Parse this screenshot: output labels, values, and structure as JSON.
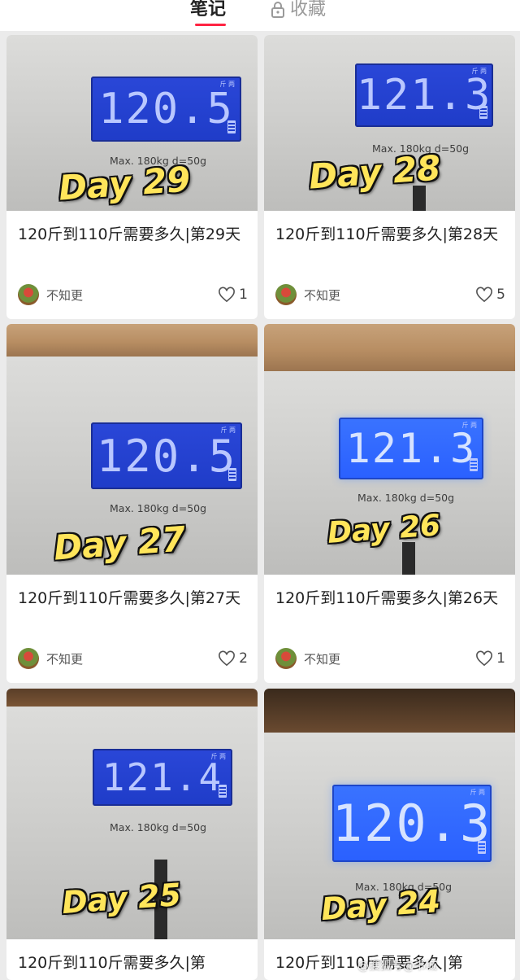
{
  "tabs": {
    "notes": "笔记",
    "favorites": "收藏"
  },
  "cards": [
    {
      "reading": "120.5",
      "scale_spec": "Max. 180kg d=50g",
      "day": "Day 29",
      "title": "120斤到110斤需要多久|第29天",
      "author": "不知更",
      "likes": "1"
    },
    {
      "reading": "121.3",
      "scale_spec": "Max. 180kg d=50g",
      "day": "Day 28",
      "title": "120斤到110斤需要多久|第28天",
      "author": "不知更",
      "likes": "5"
    },
    {
      "reading": "120.5",
      "scale_spec": "Max. 180kg d=50g",
      "day": "Day 27",
      "title": "120斤到110斤需要多久|第27天",
      "author": "不知更",
      "likes": "2"
    },
    {
      "reading": "121.3",
      "scale_spec": "Max. 180kg d=50g",
      "day": "Day 26",
      "title": "120斤到110斤需要多久|第26天",
      "author": "不知更",
      "likes": "1"
    },
    {
      "reading": "121.4",
      "scale_spec": "Max. 180kg d=50g",
      "day": "Day 25",
      "title": "120斤到110斤需要多久|第",
      "author": "",
      "likes": ""
    },
    {
      "reading": "120.3",
      "scale_spec": "Max. 180kg d=50g",
      "day": "Day 24",
      "title": "120斤到110斤需要多久|第",
      "author": "",
      "likes": ""
    }
  ],
  "lcd_unit": "斤 两",
  "watermark": "@搜狐号@书城"
}
